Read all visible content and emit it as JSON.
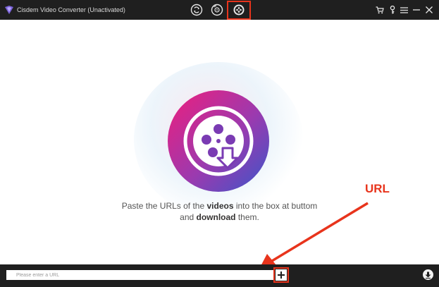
{
  "app": {
    "title": "Cisdem Video Converter (Unactivated)",
    "logo_icon": "cisdem-logo-icon"
  },
  "toolbar": {
    "modes": [
      {
        "icon": "convert-mode-icon",
        "active": false
      },
      {
        "icon": "rip-mode-icon",
        "active": false
      },
      {
        "icon": "download-mode-icon",
        "active": true
      }
    ]
  },
  "window_controls": [
    {
      "icon": "cart-icon"
    },
    {
      "icon": "key-icon"
    },
    {
      "icon": "menu-icon"
    },
    {
      "icon": "minimize-icon"
    },
    {
      "icon": "close-icon"
    }
  ],
  "main": {
    "hero_icon": "video-download-icon",
    "message": {
      "part1": "Paste the URLs of the ",
      "bold1": "videos",
      "part2": " into the box at buttom",
      "part3": "and ",
      "bold2": "download",
      "part4": " them."
    }
  },
  "annotation": {
    "label": "URL",
    "color": "#e8341c"
  },
  "bottom_bar": {
    "url_placeholder": "Please enter a URL",
    "url_value": "",
    "add_icon": "plus-icon",
    "download_icon": "download-icon"
  },
  "colors": {
    "titlebar": "#1f1f1f",
    "hero_gradient": [
      "#e5197f",
      "#8a3fb6",
      "#3f56c8"
    ]
  }
}
